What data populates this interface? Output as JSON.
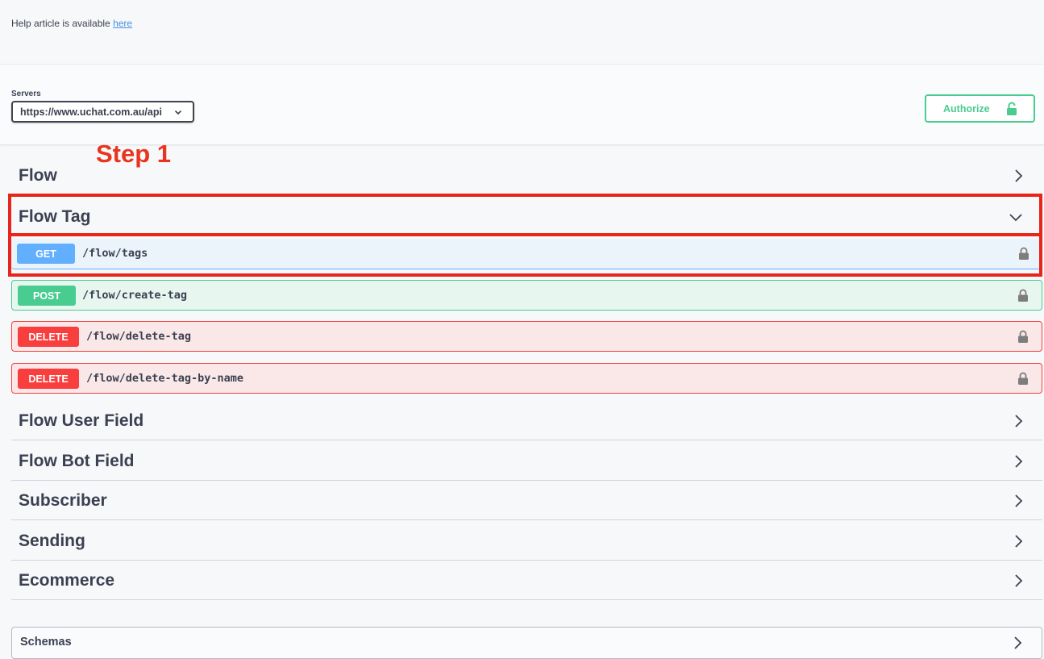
{
  "help": {
    "text": "Help article is available ",
    "link": "here"
  },
  "servers": {
    "label": "Servers",
    "selected": "https://www.uchat.com.au/api"
  },
  "authorize": {
    "label": "Authorize"
  },
  "annotation": {
    "step": "Step 1",
    "color": "#e8351f"
  },
  "tags": [
    {
      "name": "Flow",
      "expanded": false
    },
    {
      "name": "Flow Tag",
      "expanded": true
    },
    {
      "name": "Flow User Field",
      "expanded": false
    },
    {
      "name": "Flow Bot Field",
      "expanded": false
    },
    {
      "name": "Subscriber",
      "expanded": false
    },
    {
      "name": "Sending",
      "expanded": false
    },
    {
      "name": "Ecommerce",
      "expanded": false
    }
  ],
  "operations": [
    {
      "method": "GET",
      "path": "/flow/tags",
      "color": "#61affe"
    },
    {
      "method": "POST",
      "path": "/flow/create-tag",
      "color": "#49cc90"
    },
    {
      "method": "DELETE",
      "path": "/flow/delete-tag",
      "color": "#f93e3e"
    },
    {
      "method": "DELETE",
      "path": "/flow/delete-tag-by-name",
      "color": "#f93e3e"
    }
  ],
  "schemas": {
    "title": "Schemas"
  }
}
